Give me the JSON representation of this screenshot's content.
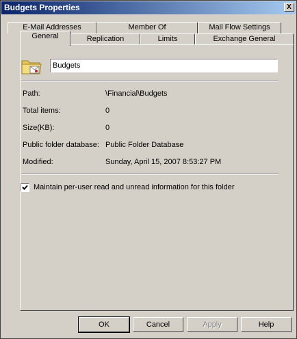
{
  "window": {
    "title": "Budgets Properties",
    "close_glyph": "X"
  },
  "tabs_back": [
    "E-Mail Addresses",
    "Member Of",
    "Mail Flow Settings"
  ],
  "tabs_front": [
    "General",
    "Replication",
    "Limits",
    "Exchange General"
  ],
  "general": {
    "name_value": "Budgets",
    "fields": [
      {
        "label": "Path:",
        "value": "\\Financial\\Budgets"
      },
      {
        "label": "Total items:",
        "value": "0"
      },
      {
        "label": "Size(KB):",
        "value": "0"
      },
      {
        "label": "Public folder database:",
        "value": "Public Folder Database"
      },
      {
        "label": "Modified:",
        "value": "Sunday, April 15, 2007 8:53:27 PM"
      }
    ],
    "maintain_per_user": {
      "label": "Maintain per-user read and unread information for this folder",
      "checked": true
    }
  },
  "buttons": {
    "ok": "OK",
    "cancel": "Cancel",
    "apply": "Apply",
    "help": "Help"
  },
  "icons": {
    "folder": "public-folder-icon",
    "check": "checkmark-icon",
    "close": "close-icon"
  }
}
